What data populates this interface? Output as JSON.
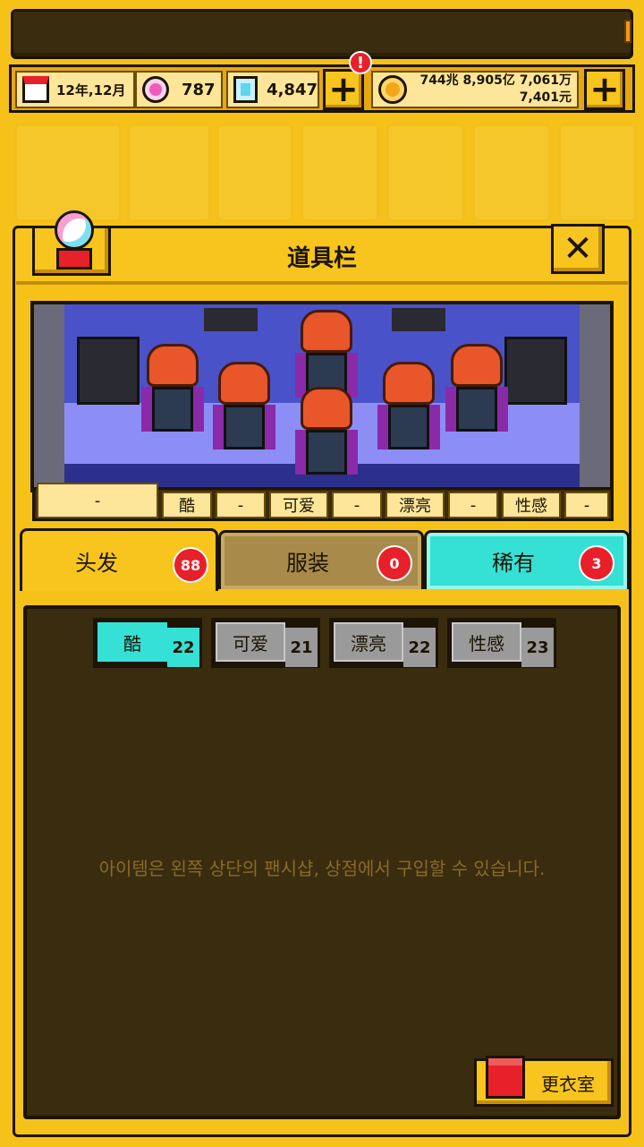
{
  "resources": {
    "date": "12年,12月",
    "pink_gems": "787",
    "blue_gems": "4,847",
    "alert": "!",
    "money_line1": "744兆 8,905亿 7,061万",
    "money_line2": "7,401元"
  },
  "panel": {
    "title": "道具栏"
  },
  "style_tags": [
    "-",
    "酷",
    "-",
    "可爱",
    "-",
    "漂亮",
    "-",
    "性感",
    "-"
  ],
  "tabs": [
    {
      "label": "头发",
      "count": "88"
    },
    {
      "label": "服装",
      "count": "0"
    },
    {
      "label": "稀有",
      "count": "3"
    }
  ],
  "filters": [
    {
      "label": "酷",
      "count": "22"
    },
    {
      "label": "可爱",
      "count": "21"
    },
    {
      "label": "漂亮",
      "count": "22"
    },
    {
      "label": "性感",
      "count": "23"
    }
  ],
  "empty_message": "아이템은 왼쪽 상단의 팬시샵, 상점에서 구입할 수 있습니다.",
  "wardrobe_button": "更衣室",
  "colors": {
    "accent_yellow": "#f6c21a",
    "dark_brown": "#3a2c0e",
    "teal": "#35e0d4",
    "badge_red": "#e8202a"
  }
}
